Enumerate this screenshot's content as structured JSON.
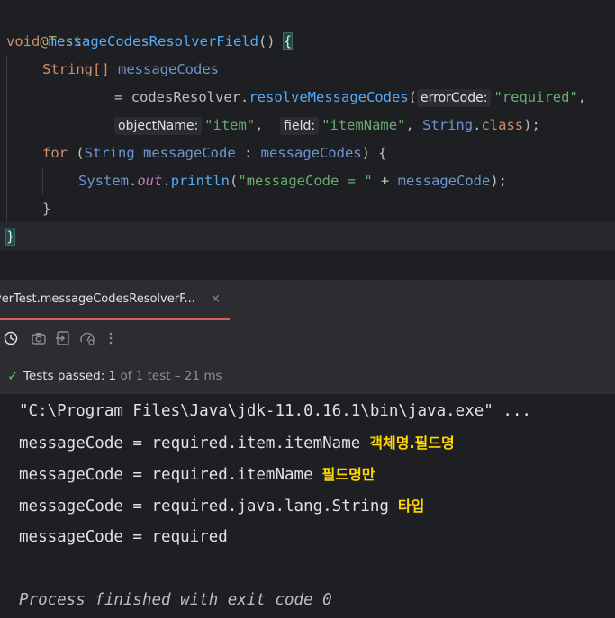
{
  "editor": {
    "annotation": "@Test",
    "kw_void": "void",
    "method_name": "messageCodesResolverField",
    "sig_rest": "() ",
    "open_brace": "{",
    "type_string_array": "String[]",
    "var_message_codes": "messageCodes",
    "eq": "= ",
    "resolver_var": "codesResolver",
    "dot": ".",
    "resolve_method": "resolveMessageCodes",
    "open_paren": "(",
    "hint_error_code": "errorCode:",
    "arg_required": "\"required\"",
    "comma": ",",
    "hint_object_name": "objectName:",
    "arg_item": "\"item\"",
    "comma_space": ",  ",
    "hint_field": "field:",
    "arg_item_name": "\"itemName\"",
    "comma2": ", ",
    "type_string": "String",
    "class_kw": "class",
    "close_stmt": ");",
    "kw_for": "for",
    "for_open": " (",
    "for_type": "String",
    "for_var": " messageCode",
    "for_colon": " : ",
    "for_iter": "messageCodes",
    "for_close": ") {",
    "system": "System",
    "out": "out",
    "println": "println",
    "print_open": "(",
    "print_str": "\"messageCode = \"",
    "print_plus": " + ",
    "print_var": "messageCode",
    "print_close": ");",
    "inner_close": "}",
    "outer_close": "}"
  },
  "tab": {
    "label": "verTest.messageCodesResolverF...",
    "close_icon": "×"
  },
  "toolbar": {
    "icons": [
      "history-icon",
      "camera-icon",
      "export-icon",
      "gauge-icon",
      "more-vertical-icon"
    ]
  },
  "status": {
    "check_icon": "✓",
    "passed_label": "Tests passed:",
    "count": "1",
    "rest": "of 1 test – 21 ms"
  },
  "console": {
    "command": "\"C:\\Program Files\\Java\\jdk-11.0.16.1\\bin\\java.exe\" ...",
    "lines": [
      {
        "text": "messageCode = required.item.itemName",
        "note": "객체명.필드명"
      },
      {
        "text": "messageCode = required.itemName",
        "note": "필드명만"
      },
      {
        "text": "messageCode = required.java.lang.String",
        "note": "타입"
      },
      {
        "text": "messageCode = required",
        "note": ""
      }
    ],
    "finished": "Process finished with exit code 0"
  },
  "colors": {
    "accent_tab": "#d95f5f",
    "pass_green": "#5fb865",
    "note_yellow": "#ffd700"
  }
}
